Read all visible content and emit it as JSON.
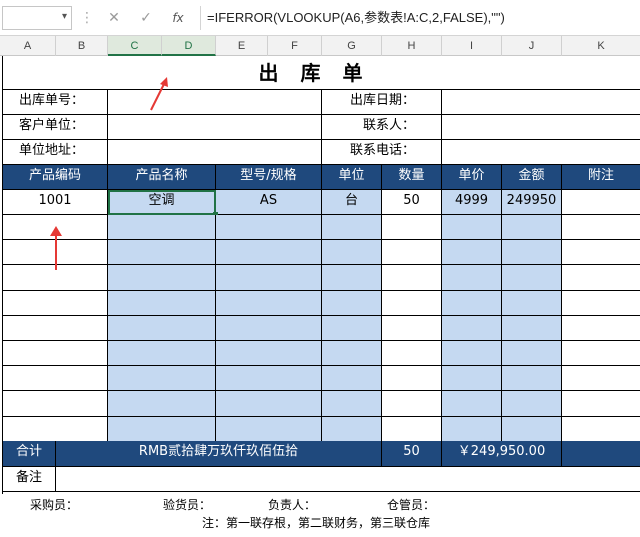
{
  "formula_bar": {
    "name_box": "",
    "cancel_icon": "✕",
    "enter_icon": "✓",
    "fx_icon": "fx",
    "formula": "=IFERROR(VLOOKUP(A6,参数表!A:C,2,FALSE),\"\")"
  },
  "columns": [
    "A",
    "B",
    "C",
    "D",
    "E",
    "F",
    "G",
    "H",
    "I",
    "J",
    "K"
  ],
  "title": "出库单",
  "header_fields": {
    "order_no_label": "出库单号：",
    "customer_label": "客户单位：",
    "address_label": "单位地址：",
    "date_label": "出库日期：",
    "contact_label": "联系人：",
    "phone_label": "联系电话："
  },
  "table": {
    "headers": [
      "产品编码",
      "产品名称",
      "型号/规格",
      "单位",
      "数量",
      "单价",
      "金额",
      "附注"
    ],
    "rows": [
      [
        "1001",
        "空调",
        "AS",
        "台",
        "50",
        "4999",
        "249950",
        ""
      ]
    ]
  },
  "totals": {
    "label": "合计",
    "amount_words": "RMB贰拾肆万玖仟玖佰伍拾",
    "qty": "50",
    "amount": "￥249,950.00"
  },
  "remark_label": "备注",
  "footer": {
    "buyer": "采购员：",
    "inspector": "验货员：",
    "manager": "负责人：",
    "keeper": "仓管员：",
    "note": "注：第一联存根，第二联财务，第三联仓库"
  },
  "colors": {
    "header_bg": "#1f497d",
    "highlight": "#c5d9f1",
    "arrow": "#e53935"
  }
}
